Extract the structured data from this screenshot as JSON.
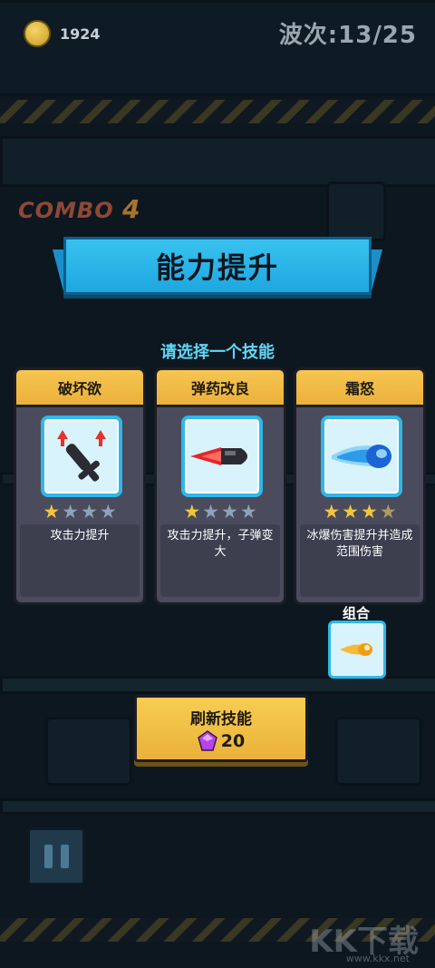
{
  "hud": {
    "coins": "1924",
    "wave": "波次:13/25"
  },
  "combo": {
    "label": "COMBO",
    "count": "4"
  },
  "banner": {
    "title": "能力提升"
  },
  "subtitle": "请选择一个技能",
  "cards": [
    {
      "title": "破坏欲",
      "icon": "sword-upgrade-icon",
      "stars": 1,
      "max_stars": 4,
      "desc": "攻击力提升"
    },
    {
      "title": "弹药改良",
      "icon": "bullet-icon",
      "stars": 1,
      "max_stars": 4,
      "desc": "攻击力提升，子弹变大"
    },
    {
      "title": "霜怒",
      "icon": "ice-blast-icon",
      "stars": 3,
      "max_stars": 4,
      "desc": "冰爆伤害提升并造成范围伤害"
    }
  ],
  "combo_slot": {
    "label": "组合",
    "icon": "fire-bullet-icon"
  },
  "refresh": {
    "label": "刷新技能",
    "cost": "20",
    "currency_icon": "purple-gem-icon"
  },
  "watermark": {
    "text": "KK下载",
    "url": "www.kkx.net"
  },
  "colors": {
    "accent_blue": "#2fb7e8",
    "card_header": "#f2b942",
    "star_on": "#f2c53c",
    "star_off": "#8ea3ba"
  }
}
